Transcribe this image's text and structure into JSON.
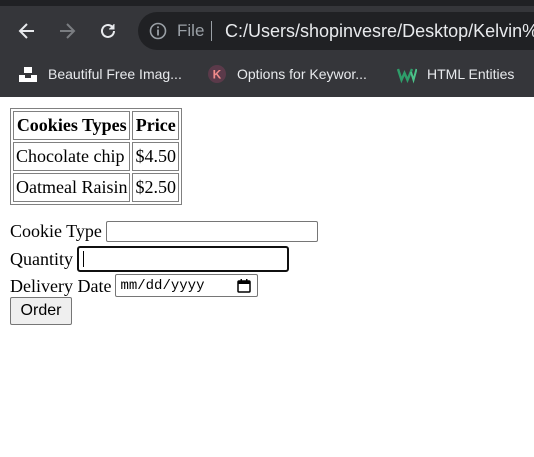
{
  "browser": {
    "scheme_label": "File",
    "url": "C:/Users/shopinvesre/Desktop/Kelvin%2",
    "bookmarks": [
      {
        "label": "Beautiful Free Imag...",
        "icon": "unsplash-icon"
      },
      {
        "label": "Options for Keywor...",
        "icon": "keyword-k-icon"
      },
      {
        "label": "HTML Entities",
        "icon": "w3-entities-icon"
      }
    ]
  },
  "table": {
    "headers": [
      "Cookies Types",
      "Price"
    ],
    "rows": [
      [
        "Chocolate chip",
        "$4.50"
      ],
      [
        "Oatmeal Raisin",
        "$2.50"
      ]
    ]
  },
  "form": {
    "cookie_type_label": "Cookie Type",
    "cookie_type_value": "",
    "quantity_label": "Quantity",
    "quantity_value": "",
    "delivery_date_label": "Delivery Date",
    "delivery_date_placeholder": "mm/dd/yyyy",
    "order_button": "Order"
  }
}
